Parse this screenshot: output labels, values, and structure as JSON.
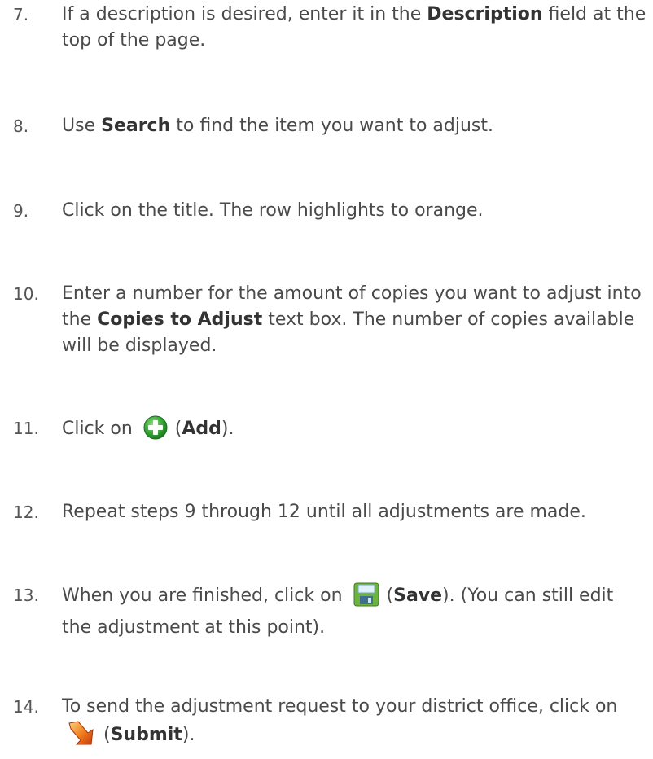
{
  "steps": [
    {
      "number": "7.",
      "parts": {
        "a": "If a description is desired, enter it in the ",
        "b": "Description",
        "c": " field at the top of the page."
      }
    },
    {
      "number": "8.",
      "parts": {
        "a": "Use ",
        "b": "Search",
        "c": " to find the item you want to adjust."
      }
    },
    {
      "number": "9.",
      "parts": {
        "a": "Click on the title. The row highlights to orange."
      }
    },
    {
      "number": "10.",
      "parts": {
        "a": "Enter a number for the amount of copies you want to adjust into the ",
        "b": "Copies to Adjust",
        "c": " text box. The number of copies available will be displayed."
      }
    },
    {
      "number": "11.",
      "parts": {
        "a": "Click on ",
        "open": " (",
        "b": "Add",
        "close": ")."
      },
      "icon": "add-icon"
    },
    {
      "number": "12.",
      "parts": {
        "a": "Repeat steps 9 through 12 until all adjustments are made."
      }
    },
    {
      "number": "13.",
      "parts": {
        "a": "When you are finished, click on ",
        "open": " (",
        "b": "Save",
        "c": "). (You can still edit the adjustment at this point)."
      },
      "icon": "save-icon"
    },
    {
      "number": "14.",
      "parts": {
        "a": "To send the adjustment request to your district office, click on ",
        "open": " (",
        "b": "Submit",
        "close": ")."
      },
      "icon": "submit-icon"
    }
  ],
  "colors": {
    "text": "#4a4a4a",
    "bold": "#333333",
    "add_icon": "#3aa83a",
    "save_icon": "#6db33f",
    "submit_icon": "#f07a1a"
  }
}
